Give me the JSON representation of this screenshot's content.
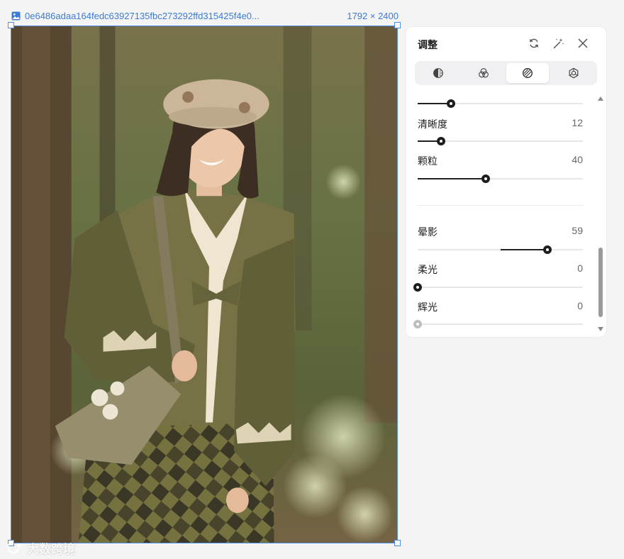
{
  "file": {
    "name": "0e6486adaa164fedc63927135fbc273292ffd315425f4e0...",
    "dimensions": "1792 × 2400",
    "icon": "image-icon"
  },
  "watermark": {
    "text": "大数跨境"
  },
  "panel": {
    "title": "调整",
    "header_icons": [
      "reset-icon",
      "magic-wand-icon",
      "close-icon"
    ],
    "tabs": [
      {
        "icon": "light-icon",
        "active": false
      },
      {
        "icon": "color-icon",
        "active": false
      },
      {
        "icon": "effects-icon",
        "active": true
      },
      {
        "icon": "detail-icon",
        "active": false
      }
    ],
    "sliders": [
      {
        "label": "",
        "value": "",
        "level": 0.2
      },
      {
        "label": "清晰度",
        "value": "12",
        "level": 0.14
      },
      {
        "label": "颗粒",
        "value": "40",
        "level": 0.41
      },
      {
        "label": "晕影",
        "value": "59",
        "level": 0.785,
        "centered": true
      },
      {
        "label": "柔光",
        "value": "0",
        "level": 0.0
      },
      {
        "label": "辉光",
        "value": "0",
        "level": 0.0,
        "disabled": true
      }
    ]
  }
}
